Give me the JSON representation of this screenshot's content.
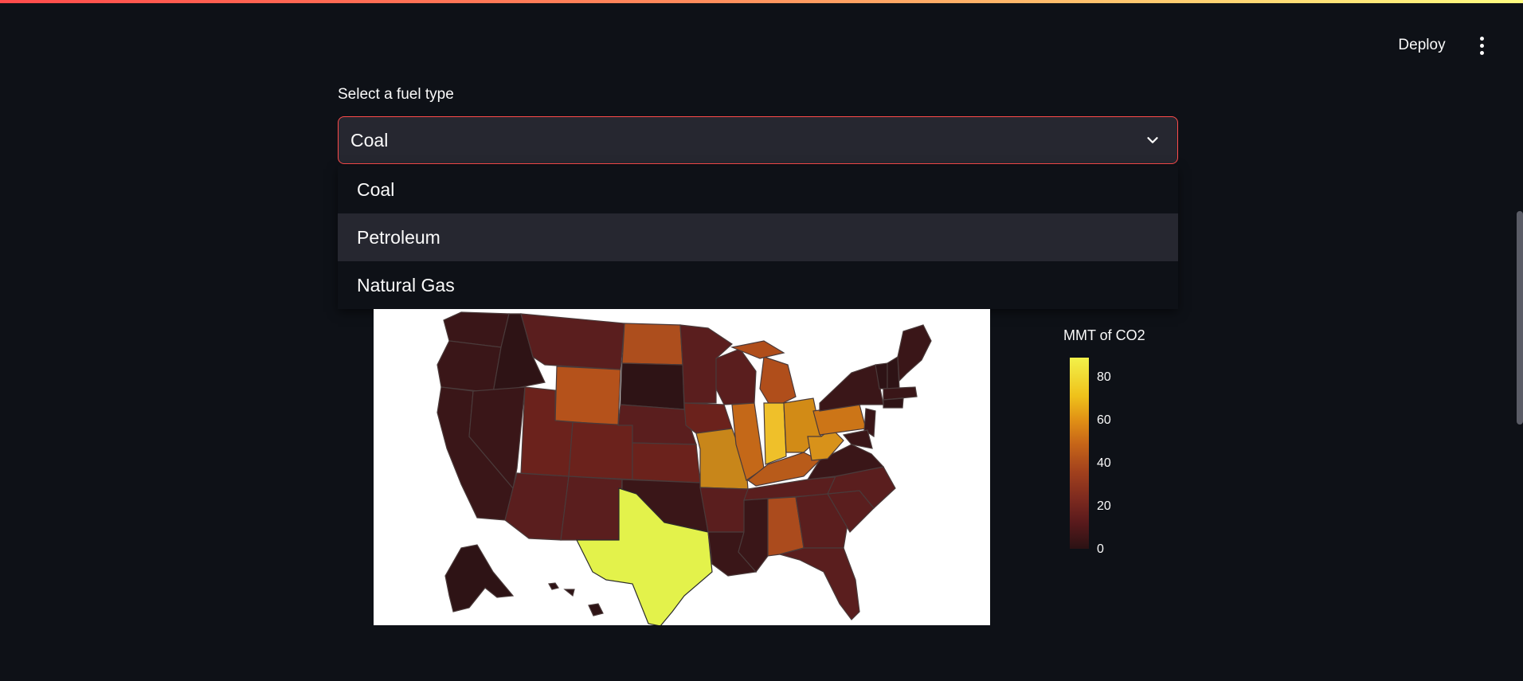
{
  "header": {
    "deploy_label": "Deploy",
    "menu_icon": "kebab-menu-icon"
  },
  "selector": {
    "label": "Select a fuel type",
    "selected": "Coal",
    "options": [
      "Coal",
      "Petroleum",
      "Natural Gas"
    ],
    "highlighted_option": "Petroleum"
  },
  "map": {
    "colorbar_title": "MMT of CO2",
    "colorbar_ticks": [
      "80",
      "60",
      "40",
      "20",
      "0"
    ],
    "colorscale": [
      "#2b1214",
      "#7d2a1f",
      "#c76618",
      "#efc21b",
      "#f2f24a"
    ],
    "state_colors": {
      "texas": "#e3f24b",
      "indiana": "#efc02a",
      "ohio": "#d28b16",
      "pennsylvania": "#cc7517",
      "missouri": "#c8861a",
      "illinois": "#c46818",
      "kentucky": "#b85b1a",
      "west_virginia": "#d8921a",
      "michigan": "#b04e1b",
      "wyoming": "#b5521b",
      "north_dakota": "#ad4e1d",
      "alabama": "#ab4b1d",
      "default_dark": "#3a1618",
      "default_mid": "#5a1e1e"
    }
  }
}
